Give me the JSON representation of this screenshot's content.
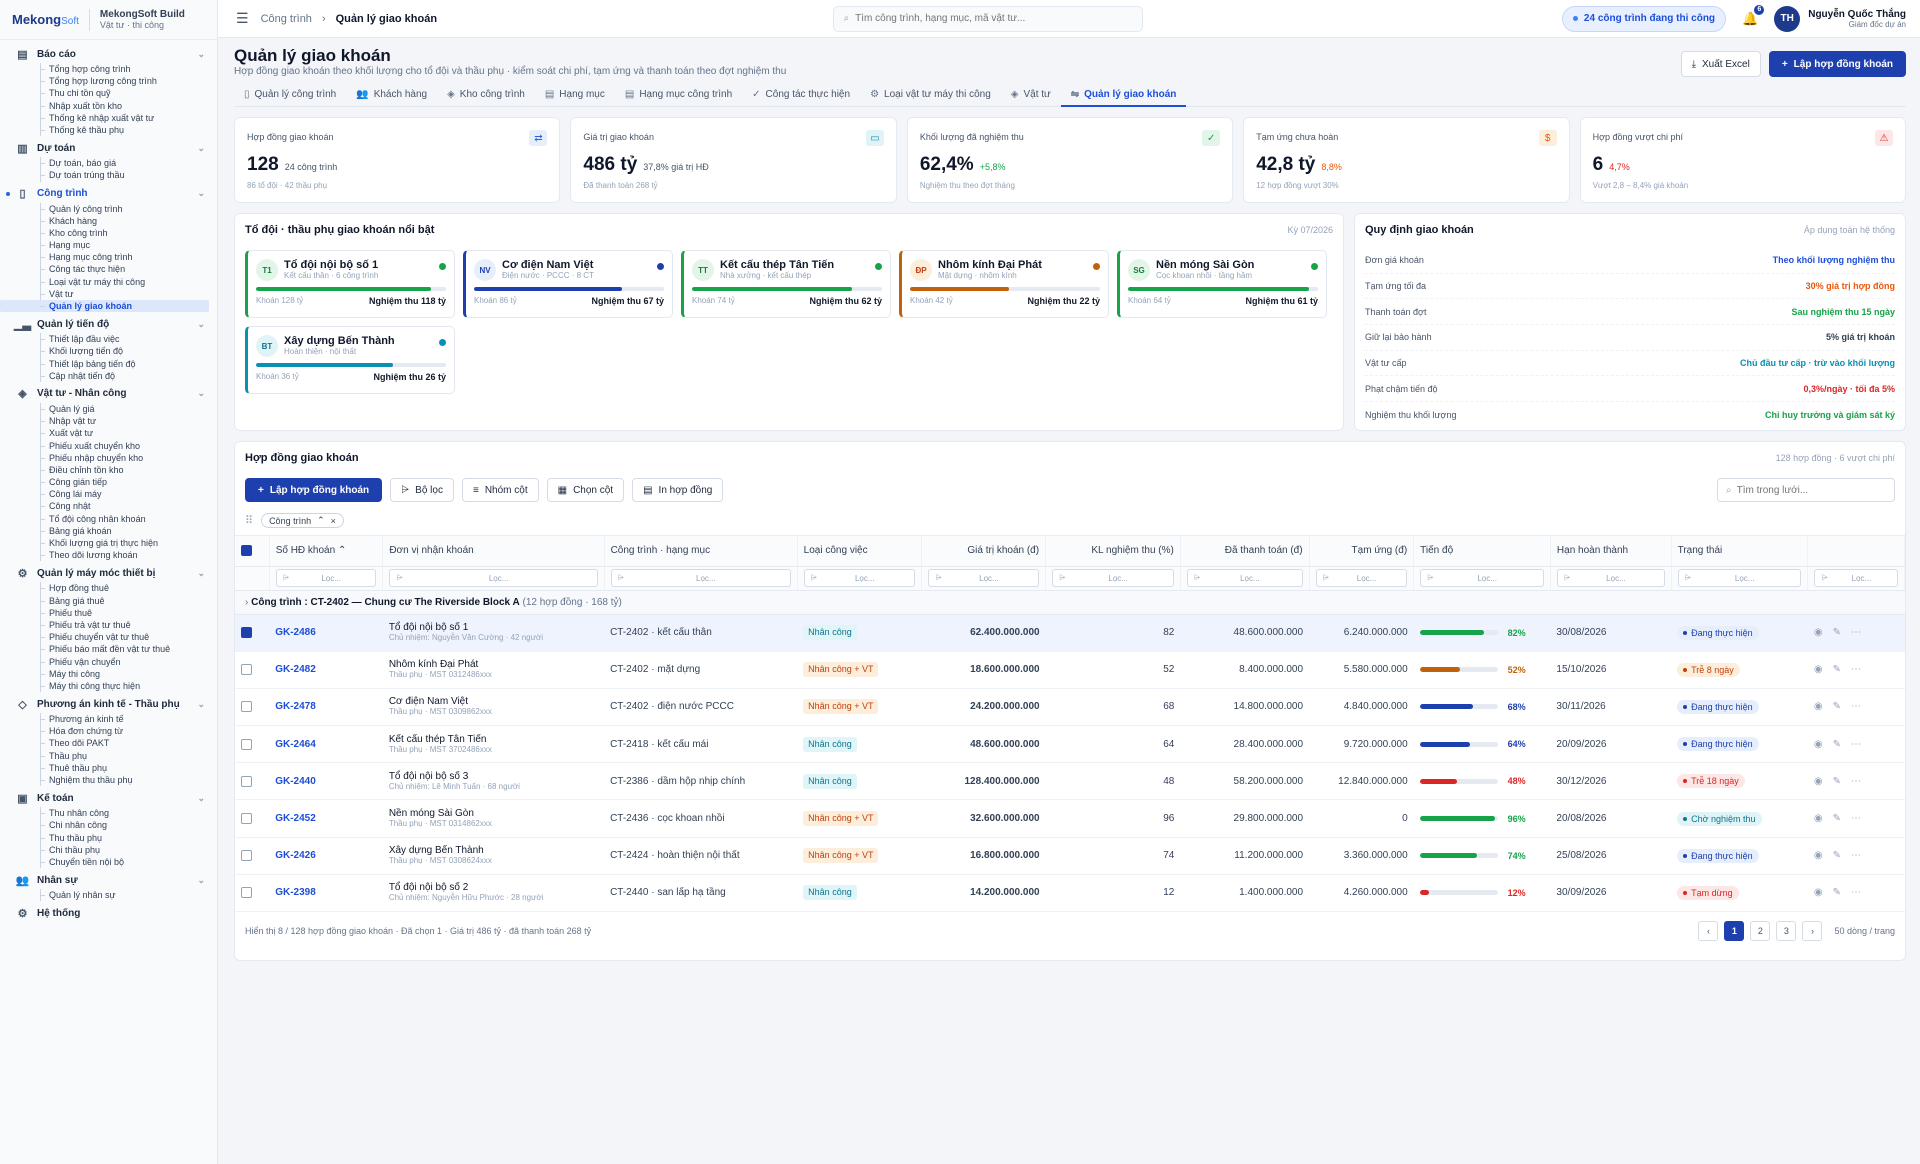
{
  "brand": {
    "logo_a": "Mekong",
    "logo_b": "Soft",
    "name": "MekongSoft Build",
    "tagline": "Vật tư · thi công"
  },
  "sidebar": [
    {
      "label": "Báo cáo",
      "icon": "report-icon",
      "items": [
        "Tổng hợp công trình",
        "Tổng hợp lương công trình",
        "Thu chi tồn quỹ",
        "Nhập xuất tồn kho",
        "Thống kê nhập xuất vật tư",
        "Thống kê thầu phụ"
      ]
    },
    {
      "label": "Dự toán",
      "icon": "estimate-icon",
      "items": [
        "Dự toán, báo giá",
        "Dự toán trúng thầu"
      ]
    },
    {
      "label": "Công trình",
      "icon": "map-icon",
      "active": true,
      "items": [
        "Quản lý công trình",
        "Khách hàng",
        "Kho công trình",
        "Hạng mục",
        "Hạng mục công trình",
        "Công tác thực hiện",
        "Loại vật tư máy thi công",
        "Vật tư",
        "Quản lý giao khoán"
      ],
      "active_item": 8
    },
    {
      "label": "Quản lý tiến độ",
      "icon": "chart-icon",
      "items": [
        "Thiết lập đầu việc",
        "Khối lượng tiến độ",
        "Thiết lập bảng tiến độ",
        "Cập nhật tiến độ"
      ]
    },
    {
      "label": "Vật tư - Nhân công",
      "icon": "box-icon",
      "items": [
        "Quản lý giá",
        "Nhập vật tư",
        "Xuất vật tư",
        "Phiếu xuất chuyển kho",
        "Phiếu nhập chuyển kho",
        "Điều chỉnh tồn kho",
        "Công gián tiếp",
        "Công lái máy",
        "Công nhật",
        "Tổ đội công nhân khoán",
        "Bảng giá khoán",
        "Khối lượng giá trị thực hiện",
        "Theo dõi lương khoán"
      ]
    },
    {
      "label": "Quản lý máy móc thiết bị",
      "icon": "gear-icon",
      "items": [
        "Hợp đồng thuê",
        "Bảng giá thuê",
        "Phiếu thuê",
        "Phiếu trả vật tư thuê",
        "Phiếu chuyển vật tư thuê",
        "Phiếu báo mất đền vật tư thuê",
        "Phiếu vận chuyển",
        "Máy thi công",
        "Máy thi công thực hiện"
      ]
    },
    {
      "label": "Phương án kinh tế - Thầu phụ",
      "icon": "tag-icon",
      "items": [
        "Phương án kinh tế",
        "Hóa đơn chứng từ",
        "Theo dõi PAKT",
        "Thầu phụ",
        "Thuê thầu phụ",
        "Nghiệm thu thầu phụ"
      ]
    },
    {
      "label": "Kế toán",
      "icon": "money-icon",
      "items": [
        "Thu nhân công",
        "Chi nhân công",
        "Thu thầu phụ",
        "Chi thầu phụ",
        "Chuyển tiền nội bộ"
      ]
    },
    {
      "label": "Nhân sự",
      "icon": "users-icon",
      "items": [
        "Quản lý nhân sự"
      ]
    },
    {
      "label": "Hệ thống",
      "icon": "settings-icon",
      "items": []
    }
  ],
  "topbar": {
    "crumb1": "Công trình",
    "crumb2": "Quản lý giao khoán",
    "search_placeholder": "Tìm công trình, hạng mục, mã vật tư...",
    "live": "24 công trình đang thi công",
    "bell_count": "6",
    "user_initials": "TH",
    "user_name": "Nguyễn Quốc Thắng",
    "user_role": "Giám đốc dự án"
  },
  "page": {
    "title": "Quản lý giao khoán",
    "subtitle": "Hợp đồng giao khoán theo khối lượng cho tổ đội và thầu phụ · kiểm soát chi phí, tạm ứng và thanh toán theo đợt nghiệm thu",
    "export": "Xuất Excel",
    "create": "Lập hợp đồng khoán"
  },
  "tabs": [
    {
      "label": "Quản lý công trình",
      "icon": "map-icon"
    },
    {
      "label": "Khách hàng",
      "icon": "users-icon"
    },
    {
      "label": "Kho công trình",
      "icon": "box-icon"
    },
    {
      "label": "Hạng mục",
      "icon": "doc-icon"
    },
    {
      "label": "Hạng mục công trình",
      "icon": "doc-icon"
    },
    {
      "label": "Công tác thực hiện",
      "icon": "check-icon"
    },
    {
      "label": "Loại vật tư máy thi công",
      "icon": "gear-icon"
    },
    {
      "label": "Vật tư",
      "icon": "box-icon"
    },
    {
      "label": "Quản lý giao khoán",
      "icon": "handshake-icon",
      "active": true
    }
  ],
  "kpis": [
    {
      "label": "Hợp đồng giao khoán",
      "value": "128",
      "delta": "24 công trình",
      "note": "86 tổ đội · 42 thầu phụ",
      "icon": "swap-icon",
      "accent": "#2563eb",
      "accent_bg": "#e6eefc",
      "delta_color": "#475569"
    },
    {
      "label": "Giá trị giao khoán",
      "value": "486 tỷ",
      "delta": "37,8% giá trị HĐ",
      "note": "Đã thanh toán 268 tỷ",
      "icon": "cash-icon",
      "accent": "#0891b2",
      "accent_bg": "#e0f4f8",
      "delta_color": "#475569"
    },
    {
      "label": "Khối lượng đã nghiệm thu",
      "value": "62,4%",
      "delta": "+5,8%",
      "note": "Nghiệm thu theo đợt tháng",
      "icon": "check-circle-icon",
      "accent": "#16a34a",
      "accent_bg": "#e3f5e9",
      "delta_color": "#16a34a"
    },
    {
      "label": "Tạm ứng chưa hoàn",
      "value": "42,8 tỷ",
      "delta": "8,8%",
      "note": "12 hợp đồng vượt 30%",
      "icon": "dollar-icon",
      "accent": "#ea580c",
      "accent_bg": "#fdeedb",
      "delta_color": "#ea580c"
    },
    {
      "label": "Hợp đồng vượt chi phí",
      "value": "6",
      "delta": "4,7%",
      "note": "Vượt 2,8 – 8,4% giá khoán",
      "icon": "warning-icon",
      "accent": "#dc2626",
      "accent_bg": "#fde6e6",
      "delta_color": "#dc2626"
    }
  ],
  "teams": {
    "title": "Tổ đội · thầu phụ giao khoán nổi bật",
    "period": "Kỳ 07/2026",
    "items": [
      {
        "abbr": "T1",
        "name": "Tổ đội nội bộ số 1",
        "sub": "Kết cấu thân · 6 công trình",
        "khoan": "Khoán 128 tỷ",
        "nt": "Nghiệm thu 118 tỷ",
        "pct": 92,
        "color": "#16a34a",
        "bg": "#e3f5e9",
        "fg": "#15803d"
      },
      {
        "abbr": "NV",
        "name": "Cơ điện Nam Việt",
        "sub": "Điện nước · PCCC · 8 CT",
        "khoan": "Khoán 86 tỷ",
        "nt": "Nghiệm thu 67 tỷ",
        "pct": 78,
        "color": "#1e40af",
        "bg": "#e6eefc",
        "fg": "#1e40af"
      },
      {
        "abbr": "TT",
        "name": "Kết cấu thép Tân Tiến",
        "sub": "Nhà xưởng · kết cấu thép",
        "khoan": "Khoán 74 tỷ",
        "nt": "Nghiệm thu 62 tỷ",
        "pct": 84,
        "color": "#16a34a",
        "bg": "#e3f5e9",
        "fg": "#15803d"
      },
      {
        "abbr": "ĐP",
        "name": "Nhôm kính Đại Phát",
        "sub": "Mặt dựng · nhôm kính",
        "khoan": "Khoán 42 tỷ",
        "nt": "Nghiệm thu 22 tỷ",
        "pct": 52,
        "color": "#c2610c",
        "bg": "#fdeedb",
        "fg": "#c2410c"
      },
      {
        "abbr": "SG",
        "name": "Nền móng Sài Gòn",
        "sub": "Cọc khoan nhồi · tầng hầm",
        "khoan": "Khoán 64 tỷ",
        "nt": "Nghiệm thu 61 tỷ",
        "pct": 95,
        "color": "#16a34a",
        "bg": "#e3f5e9",
        "fg": "#15803d"
      },
      {
        "abbr": "BT",
        "name": "Xây dựng Bến Thành",
        "sub": "Hoàn thiện · nội thất",
        "khoan": "Khoán 36 tỷ",
        "nt": "Nghiệm thu 26 tỷ",
        "pct": 72,
        "color": "#0891b2",
        "bg": "#e0f4f8",
        "fg": "#0e7490"
      }
    ]
  },
  "rules": {
    "title": "Quy định giao khoán",
    "scope": "Áp dụng toàn hệ thống",
    "items": [
      {
        "k": "Đơn giá khoán",
        "v": "Theo khối lượng nghiệm thu",
        "color": "#1d4ed8"
      },
      {
        "k": "Tạm ứng tối đa",
        "v": "30% giá trị hợp đồng",
        "color": "#ea580c"
      },
      {
        "k": "Thanh toán đợt",
        "v": "Sau nghiệm thu 15 ngày",
        "color": "#16a34a"
      },
      {
        "k": "Giữ lại bảo hành",
        "v": "5% giá trị khoán",
        "color": "#334155"
      },
      {
        "k": "Vật tư cấp",
        "v": "Chủ đầu tư cấp · trừ vào khối lượng",
        "color": "#0891b2"
      },
      {
        "k": "Phạt chậm tiến độ",
        "v": "0,3%/ngày · tối đa 5%",
        "color": "#dc2626"
      },
      {
        "k": "Nghiệm thu khối lượng",
        "v": "Chỉ huy trưởng và giám sát ký",
        "color": "#16a34a"
      }
    ]
  },
  "grid": {
    "title": "Hợp đồng giao khoán",
    "meta": "128 hợp đồng · 6 vượt chi phí",
    "btn_create": "Lập hợp đồng khoán",
    "btn_filter": "Bộ lọc",
    "btn_group": "Nhóm cột",
    "btn_cols": "Chọn cột",
    "btn_print": "In hợp đồng",
    "search_placeholder": "Tìm trong lưới...",
    "group_chip": "Công trình",
    "filter_placeholder": "Lọc...",
    "columns": [
      "Số HĐ khoán",
      "Đơn vị nhận khoán",
      "Công trình · hạng mục",
      "Loại công việc",
      "Giá trị khoán (đ)",
      "KL nghiệm thu (%)",
      "Đã thanh toán (đ)",
      "Tạm ứng (đ)",
      "Tiến độ",
      "Hạn hoàn thành",
      "Trạng thái"
    ],
    "group_label": "Công trình",
    "group_value": "CT-2402 — Chung cư The Riverside Block A",
    "group_meta": "(12 hợp đồng · 168 tỷ)",
    "rows": [
      {
        "code": "GK-2486",
        "unit": "Tổ đội nội bộ số 1",
        "unit_sub": "Chủ nhiệm: Nguyễn Văn Cường · 42 người",
        "ct": "CT-2402 · kết cấu thân",
        "type": "Nhân công",
        "type_vt": false,
        "value": "62.400.000.000",
        "kl": "82",
        "paid": "48.600.000.000",
        "adv": "6.240.000.000",
        "pct": 82,
        "pct_label": "82%",
        "pcolor": "#16a34a",
        "due": "30/08/2026",
        "status": "Đang thực hiện",
        "sbg": "#e6eefc",
        "sfg": "#1e40af",
        "selected": true
      },
      {
        "code": "GK-2482",
        "unit": "Nhôm kính Đại Phát",
        "unit_sub": "Thầu phụ · MST 0312486xxx",
        "ct": "CT-2402 · mặt dựng",
        "type": "Nhân công + VT",
        "type_vt": true,
        "value": "18.600.000.000",
        "kl": "52",
        "paid": "8.400.000.000",
        "adv": "5.580.000.000",
        "pct": 52,
        "pct_label": "52%",
        "pcolor": "#c2610c",
        "due": "15/10/2026",
        "status": "Trễ 8 ngày",
        "sbg": "#fdeedb",
        "sfg": "#c2410c"
      },
      {
        "code": "GK-2478",
        "unit": "Cơ điện Nam Việt",
        "unit_sub": "Thầu phụ · MST 0309862xxx",
        "ct": "CT-2402 · điện nước PCCC",
        "type": "Nhân công + VT",
        "type_vt": true,
        "value": "24.200.000.000",
        "kl": "68",
        "paid": "14.800.000.000",
        "adv": "4.840.000.000",
        "pct": 68,
        "pct_label": "68%",
        "pcolor": "#1e40af",
        "due": "30/11/2026",
        "status": "Đang thực hiện",
        "sbg": "#e6eefc",
        "sfg": "#1e40af"
      },
      {
        "code": "GK-2464",
        "unit": "Kết cấu thép Tân Tiến",
        "unit_sub": "Thầu phụ · MST 3702486xxx",
        "ct": "CT-2418 · kết cấu mái",
        "type": "Nhân công",
        "type_vt": false,
        "value": "48.600.000.000",
        "kl": "64",
        "paid": "28.400.000.000",
        "adv": "9.720.000.000",
        "pct": 64,
        "pct_label": "64%",
        "pcolor": "#1e40af",
        "due": "20/09/2026",
        "status": "Đang thực hiện",
        "sbg": "#e6eefc",
        "sfg": "#1e40af"
      },
      {
        "code": "GK-2440",
        "unit": "Tổ đội nội bộ số 3",
        "unit_sub": "Chủ nhiệm: Lê Minh Tuấn · 68 người",
        "ct": "CT-2386 · dầm hộp nhịp chính",
        "type": "Nhân công",
        "type_vt": false,
        "value": "128.400.000.000",
        "kl": "48",
        "paid": "58.200.000.000",
        "adv": "12.840.000.000",
        "pct": 48,
        "pct_label": "48%",
        "pcolor": "#dc2626",
        "due": "30/12/2026",
        "status": "Trễ 18 ngày",
        "sbg": "#fde6e6",
        "sfg": "#dc2626"
      },
      {
        "code": "GK-2452",
        "unit": "Nền móng Sài Gòn",
        "unit_sub": "Thầu phụ · MST 0314862xxx",
        "ct": "CT-2436 · cọc khoan nhồi",
        "type": "Nhân công + VT",
        "type_vt": true,
        "value": "32.600.000.000",
        "kl": "96",
        "paid": "29.800.000.000",
        "adv": "0",
        "pct": 96,
        "pct_label": "96%",
        "pcolor": "#16a34a",
        "due": "20/08/2026",
        "status": "Chờ nghiệm thu",
        "sbg": "#e0f4f8",
        "sfg": "#0e7490"
      },
      {
        "code": "GK-2426",
        "unit": "Xây dựng Bến Thành",
        "unit_sub": "Thầu phụ · MST 0308624xxx",
        "ct": "CT-2424 · hoàn thiện nội thất",
        "type": "Nhân công + VT",
        "type_vt": true,
        "value": "16.800.000.000",
        "kl": "74",
        "paid": "11.200.000.000",
        "adv": "3.360.000.000",
        "pct": 74,
        "pct_label": "74%",
        "pcolor": "#16a34a",
        "due": "25/08/2026",
        "status": "Đang thực hiện",
        "sbg": "#e6eefc",
        "sfg": "#1e40af"
      },
      {
        "code": "GK-2398",
        "unit": "Tổ đội nội bộ số 2",
        "unit_sub": "Chủ nhiệm: Nguyễn Hữu Phước · 28 người",
        "ct": "CT-2440 · san lấp hạ tầng",
        "type": "Nhân công",
        "type_vt": false,
        "value": "14.200.000.000",
        "kl": "12",
        "paid": "1.400.000.000",
        "adv": "4.260.000.000",
        "pct": 12,
        "pct_label": "12%",
        "pcolor": "#dc2626",
        "due": "30/09/2026",
        "status": "Tạm dừng",
        "sbg": "#fde6e6",
        "sfg": "#dc2626"
      }
    ],
    "footer": "Hiển thị 8 / 128 hợp đồng giao khoán · Đã chọn 1 · Giá trị 486 tỷ · đã thanh toán 268 tỷ",
    "pages": [
      "1",
      "2",
      "3"
    ],
    "page_size": "50 dòng / trang"
  }
}
